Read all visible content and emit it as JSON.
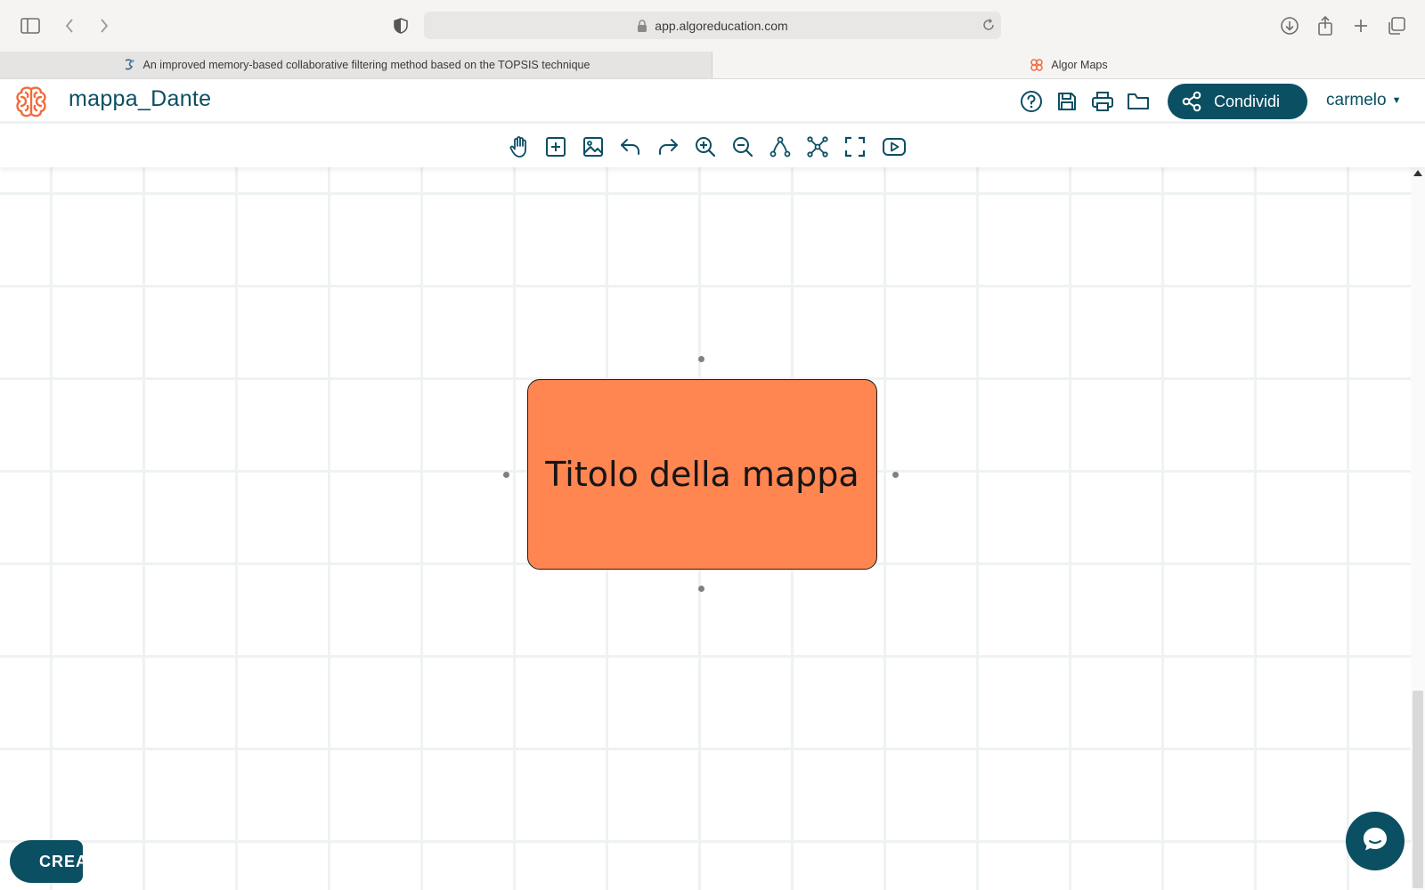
{
  "browser": {
    "url": "app.algoreducation.com",
    "tabs": [
      {
        "title": "An improved memory-based collaborative filtering method based on the TOPSIS technique",
        "active": false
      },
      {
        "title": "Algor Maps",
        "active": true
      }
    ]
  },
  "header": {
    "map_title": "mappa_Dante",
    "share_label": "Condividi",
    "user_name": "carmelo",
    "icons": [
      "help-icon",
      "save-icon",
      "print-icon",
      "folder-icon"
    ]
  },
  "toolbar": {
    "tools": [
      "hand-icon",
      "add-node-icon",
      "image-icon",
      "undo-icon",
      "redo-icon",
      "zoom-in-icon",
      "zoom-out-icon",
      "connect-icon",
      "layout-icon",
      "fullscreen-icon",
      "present-icon"
    ]
  },
  "canvas": {
    "node": {
      "label": "Titolo della mappa",
      "color": "#ff8551"
    }
  },
  "footer": {
    "create_label": "CREA"
  },
  "colors": {
    "brand": "#0b4f63",
    "logo": "#f26b3a",
    "grid": "#eef2f3"
  }
}
